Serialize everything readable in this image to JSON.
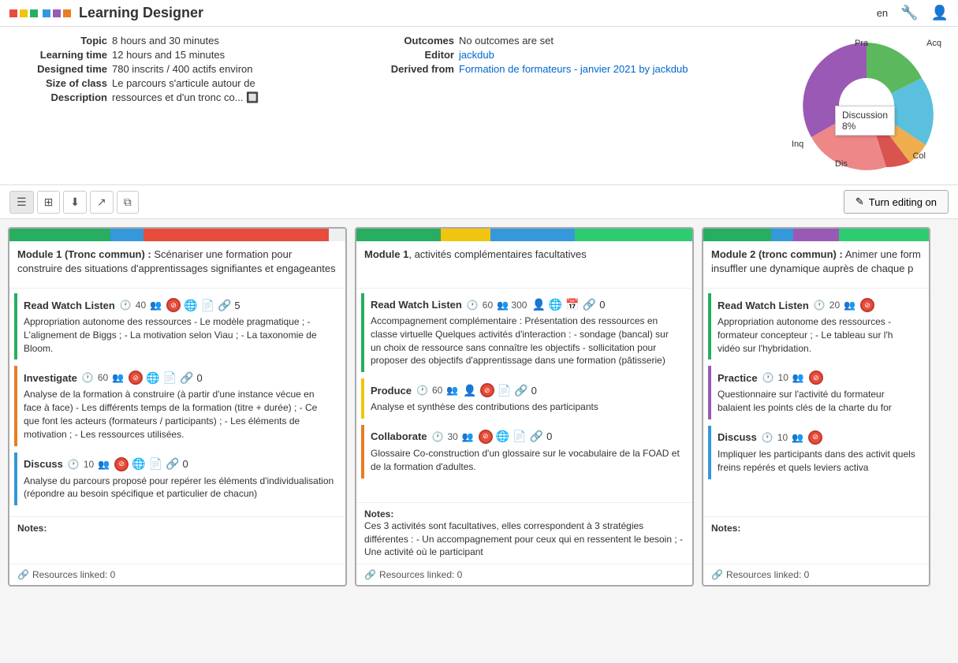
{
  "app": {
    "title": "Learning Designer",
    "lang": "en"
  },
  "info": {
    "topic_label": "Topic",
    "topic_value": "8 hours and 30 minutes",
    "learning_time_label": "Learning time",
    "learning_time_value": "12 hours and 15 minutes",
    "designed_time_label": "Designed time",
    "designed_time_value": "780 inscrits / 400 actifs environ",
    "size_of_class_label": "Size of class",
    "size_of_class_value": "Le parcours s'articule autour de",
    "description_label": "Description",
    "description_value": "ressources et d'un tronc co...",
    "outcomes_label": "Outcomes",
    "outcomes_value": "No outcomes are set",
    "editor_label": "Editor",
    "editor_value": "jackdub",
    "derived_from_label": "Derived from",
    "derived_from_value": "Formation de formateurs - janvier 2021 by jackdub"
  },
  "chart": {
    "tooltip_label": "Discussion",
    "tooltip_value": "8%",
    "labels": [
      "Pra",
      "Acq",
      "Col",
      "Dis",
      "Inq"
    ]
  },
  "toolbar": {
    "turn_editing_label": "Turn editing on",
    "buttons": [
      "list-view",
      "grid-view",
      "download",
      "export",
      "copy"
    ]
  },
  "columns": [
    {
      "id": "col1",
      "header_bars": [
        {
          "color": "#27ae60",
          "width": "30%"
        },
        {
          "color": "#3498db",
          "width": "10%"
        },
        {
          "color": "#e74c3c",
          "width": "55%"
        },
        {
          "color": "#ecf0f1",
          "width": "5%"
        }
      ],
      "title": "Module 1 (Tronc commun) : Scénariser une formation pour construire des situations d'apprentissages signifiantes et engageantes",
      "activities": [
        {
          "type": "Read Watch Listen",
          "border": "rwl",
          "time": "40",
          "people": "👥",
          "icons": [
            "blocked",
            "globe",
            "doc",
            "link5"
          ],
          "link_count": "5",
          "desc": "Appropriation autonome des ressources - Le modèle pragmatique ; - L'alignement de Biggs ; - La motivation selon Viau ; - La taxonomie de Bloom."
        },
        {
          "type": "Investigate",
          "border": "investigate",
          "time": "60",
          "people": "👥",
          "icons": [
            "blocked",
            "globe",
            "doc",
            "link0"
          ],
          "link_count": "0",
          "desc": "Analyse de la formation à construire (à partir d'une instance vécue en face à face) - Les différents temps de la formation (titre + durée) ; - Ce que font les acteurs (formateurs / participants) ; - Les éléments de motivation ; - Les ressources utilisées."
        },
        {
          "type": "Discuss",
          "border": "discuss",
          "time": "10",
          "people": "👥",
          "icons": [
            "blocked",
            "globe",
            "doc",
            "link0"
          ],
          "link_count": "0",
          "desc": "Analyse du parcours proposé pour repérer les éléments d'individualisation (répondre au besoin spécifique et particulier de chacun)"
        }
      ],
      "notes_label": "Notes:",
      "notes_text": "",
      "resources_label": "Resources linked: 0"
    },
    {
      "id": "col2",
      "header_bars": [
        {
          "color": "#27ae60",
          "width": "25%"
        },
        {
          "color": "#f1c40f",
          "width": "15%"
        },
        {
          "color": "#3498db",
          "width": "25%"
        },
        {
          "color": "#2ecc71",
          "width": "35%"
        }
      ],
      "title": "Module 1, activités complémentaires facultatives",
      "activities": [
        {
          "type": "Read Watch Listen",
          "border": "rwl",
          "time": "60",
          "people": "300",
          "icons": [
            "person",
            "globe",
            "cal",
            "link0"
          ],
          "link_count": "0",
          "desc": "Accompagnement complémentaire : Présentation des ressources en classe virtuelle Quelques activités d'interaction : - sondage (bancal) sur un choix de ressource sans connaître les objectifs - sollicitation pour proposer des objectifs d'apprentissage dans une formation (pâtisserie)"
        },
        {
          "type": "Produce",
          "border": "produce",
          "time": "60",
          "people": "👥",
          "icons": [
            "person",
            "blocked",
            "doc",
            "link0"
          ],
          "link_count": "0",
          "desc": "Analyse et synthèse des contributions des participants"
        },
        {
          "type": "Collaborate",
          "border": "collaborate",
          "time": "30",
          "people": "👥",
          "icons": [
            "blocked",
            "globe",
            "doc",
            "link0"
          ],
          "link_count": "0",
          "desc": "Glossaire Co-construction d'un glossaire sur le vocabulaire de la FOAD et de la formation d'adultes."
        }
      ],
      "notes_label": "Notes:",
      "notes_text": "Ces 3 activités sont facultatives, elles correspondent à 3 stratégies différentes : - Un accompagnement pour ceux qui en ressentent le besoin ; - Une activité où le participant",
      "resources_label": "Resources linked: 0"
    },
    {
      "id": "col3",
      "header_bars": [
        {
          "color": "#27ae60",
          "width": "30%"
        },
        {
          "color": "#3498db",
          "width": "10%"
        },
        {
          "color": "#9b59b6",
          "width": "20%"
        },
        {
          "color": "#2ecc71",
          "width": "40%"
        }
      ],
      "title": "Module 2 (tronc commun) : Animer une form insuffler une dynamique auprès de chaque p",
      "activities": [
        {
          "type": "Read Watch Listen",
          "border": "rwl",
          "time": "20",
          "people": "👥",
          "icons": [
            "blocked"
          ],
          "link_count": "",
          "desc": "Appropriation autonome des ressources - formateur concepteur ; - Le tableau sur l'h vidéo sur l'hybridation."
        },
        {
          "type": "Practice",
          "border": "practice",
          "time": "10",
          "people": "👥",
          "icons": [
            "blocked"
          ],
          "link_count": "",
          "desc": "Questionnaire sur l'activité du formateur balaient les points clés de la charte du for"
        },
        {
          "type": "Discuss",
          "border": "discuss",
          "time": "10",
          "people": "👥",
          "icons": [
            "blocked"
          ],
          "link_count": "",
          "desc": "Impliquer les participants dans des activit quels freins repérés et quels leviers activa"
        }
      ],
      "notes_label": "Notes:",
      "notes_text": "",
      "resources_label": "Resources linked: 0"
    }
  ],
  "icons": {
    "list_view": "☰",
    "grid_view": "⊞",
    "download": "⬇",
    "export": "↗",
    "copy": "⧉",
    "edit": "✎",
    "wrench": "🔧",
    "user": "👤",
    "clock": "🕐",
    "people": "👥",
    "globe": "🌐",
    "doc": "📄",
    "link": "🔗",
    "blocked": "🚫",
    "person": "👤",
    "cal": "📅"
  }
}
